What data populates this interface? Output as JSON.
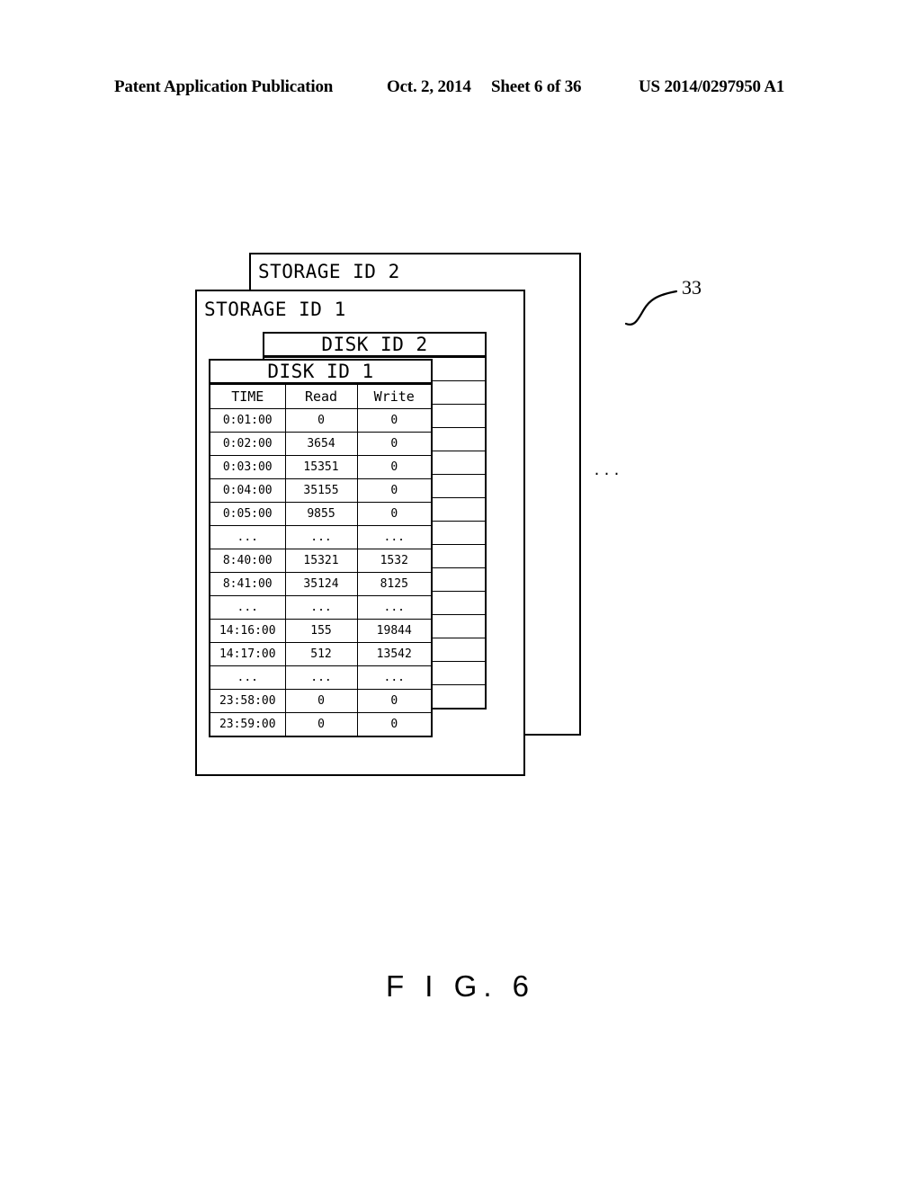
{
  "header": {
    "publication": "Patent Application Publication",
    "date": "Oct. 2, 2014",
    "sheet": "Sheet 6 of 36",
    "number": "US 2014/0297950 A1"
  },
  "figure": {
    "caption": "F I G.  6",
    "reference_numeral": "33"
  },
  "diagram": {
    "storage_2": {
      "title": "STORAGE ID 2"
    },
    "storage_1": {
      "title": "STORAGE ID 1"
    },
    "disk_2": {
      "title": "DISK ID 2",
      "ellipsis_cell": "...",
      "ellipsis_row_count": 15
    },
    "disk_1": {
      "title": "DISK ID 1",
      "columns": [
        "TIME",
        "Read",
        "Write"
      ],
      "rows": [
        [
          "0:01:00",
          "0",
          "0"
        ],
        [
          "0:02:00",
          "3654",
          "0"
        ],
        [
          "0:03:00",
          "15351",
          "0"
        ],
        [
          "0:04:00",
          "35155",
          "0"
        ],
        [
          "0:05:00",
          "9855",
          "0"
        ],
        [
          "...",
          "...",
          "..."
        ],
        [
          "8:40:00",
          "15321",
          "1532"
        ],
        [
          "8:41:00",
          "35124",
          "8125"
        ],
        [
          "...",
          "...",
          "..."
        ],
        [
          "14:16:00",
          "155",
          "19844"
        ],
        [
          "14:17:00",
          "512",
          "13542"
        ],
        [
          "...",
          "...",
          "..."
        ],
        [
          "23:58:00",
          "0",
          "0"
        ],
        [
          "23:59:00",
          "0",
          "0"
        ]
      ]
    },
    "ellipsis_disk_series": "...",
    "ellipsis_storage_series": "..."
  },
  "colors": {
    "ink": "#000000",
    "paper": "#ffffff"
  }
}
